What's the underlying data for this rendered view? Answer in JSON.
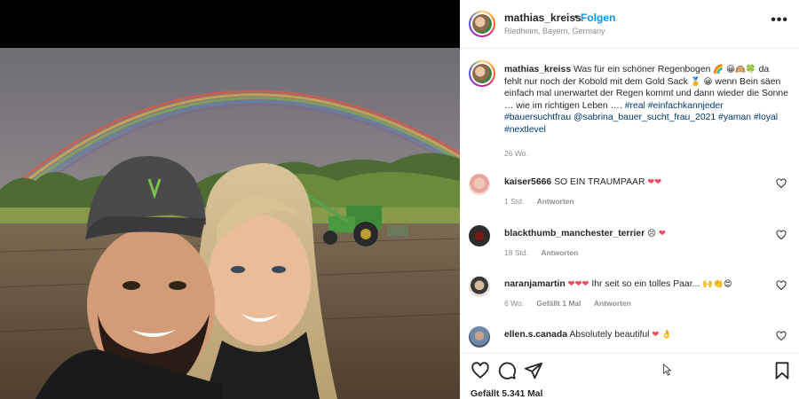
{
  "post": {
    "username": "mathias_kreiss",
    "dot": "•",
    "follow_label": "Folgen",
    "location": "Riedheim, Bayern, Germany",
    "more_label": "•••"
  },
  "caption": {
    "username": "mathias_kreiss",
    "text_1": "Was für ein schöner Regenbogen",
    "emoji_1": "🌈 😀🙉🍀",
    "text_2": "da fehlt nur noch der Kobold mit dem Gold Sack",
    "emoji_2": "🏅 😀",
    "text_3": "wenn Bein säen einfach mal unerwartet der Regen kommt und dann wieder die Sonne … wie im richtigen Leben ….",
    "tags_1": "#real #einfachkannjeder",
    "tags_2": "#bauersuchtfrau @sabrina_bauer_sucht_frau_2021 #yaman #loyal",
    "tags_3": "#nextlevel",
    "time": "26 Wo."
  },
  "comments": [
    {
      "username": "kaiser5666",
      "text": "SO EIN TRAUMPAAR",
      "hearts": "❤❤",
      "time": "1 Std.",
      "likes": "",
      "reply": "Antworten"
    },
    {
      "username": "blackthumb_manchester_terrier",
      "text": "😣",
      "hearts": "❤",
      "time": "18 Std.",
      "likes": "",
      "reply": "Antworten"
    },
    {
      "username": "naranjamartin",
      "text": "Ihr seit so ein tolles Paar...",
      "hearts": "❤❤❤",
      "emoji": "🙌👏😍",
      "time": "6 Wo.",
      "likes": "Gefällt 1 Mal",
      "reply": "Antworten"
    },
    {
      "username": "ellen.s.canada",
      "text": "Absolutely beautiful",
      "hearts": "❤",
      "emoji": "👌",
      "time": "",
      "likes": "",
      "reply": ""
    }
  ],
  "footer": {
    "likes": "Gefällt 5.341 Mal"
  },
  "icons": {
    "like": "heart-icon",
    "comment": "comment-icon",
    "share": "paper-plane-icon",
    "save": "bookmark-icon",
    "more": "more-icon"
  },
  "colors": {
    "follow": "#0095f6",
    "hashtag": "#00376b",
    "heart": "#ed4956",
    "muted": "#8e8e8e"
  }
}
